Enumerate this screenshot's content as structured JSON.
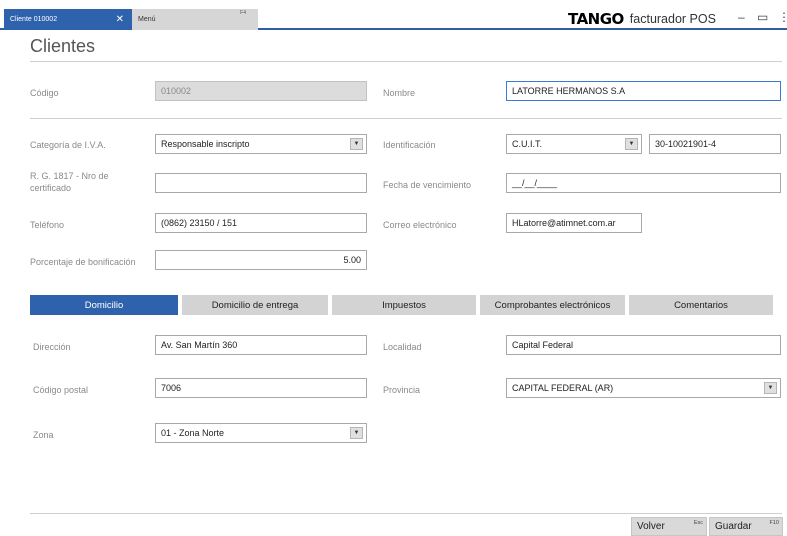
{
  "tabs": {
    "active_label": "Cliente 010002",
    "menu_label": "Menú",
    "menu_key": "F4"
  },
  "brand": {
    "logo": "TANGO",
    "product": "facturador POS"
  },
  "window": {
    "minimize": "–",
    "maximize": "▭",
    "more": "⋮"
  },
  "page": {
    "title": "Clientes"
  },
  "form": {
    "codigo_label": "Código",
    "codigo_value": "010002",
    "nombre_label": "Nombre",
    "nombre_value": "LATORRE HERMANOS S.A",
    "iva_label": "Categoría de I.V.A.",
    "iva_value": "Responsable inscripto",
    "ident_label": "Identificación",
    "ident_type": "C.U.I.T.",
    "ident_value": "30-10021901-4",
    "rg_label": "R. G. 1817 - Nro de certificado",
    "rg_value": "",
    "venc_label": "Fecha de vencimiento",
    "venc_value": "__/__/____",
    "tel_label": "Teléfono",
    "tel_value": "(0862) 23150 / 151",
    "email_label": "Correo electrónico",
    "email_value": "HLatorre@atimnet.com.ar",
    "bonif_label": "Porcentaje de bonificación",
    "bonif_value": "5.00"
  },
  "section_tabs": [
    "Domicilio",
    "Domicilio de entrega",
    "Impuestos",
    "Comprobantes electrónicos",
    "Comentarios"
  ],
  "domicilio": {
    "direccion_label": "Dirección",
    "direccion_value": "Av. San Martín 360",
    "localidad_label": "Localidad",
    "localidad_value": "Capital Federal",
    "cp_label": "Código postal",
    "cp_value": "7006",
    "provincia_label": "Provincia",
    "provincia_value": "CAPITAL FEDERAL (AR)",
    "zona_label": "Zona",
    "zona_value": "01 - Zona Norte"
  },
  "buttons": {
    "volver": "Volver",
    "volver_key": "Esc",
    "guardar": "Guardar",
    "guardar_key": "F10"
  },
  "colors": {
    "accent": "#2f62ad",
    "focus": "#3a7bd5"
  }
}
